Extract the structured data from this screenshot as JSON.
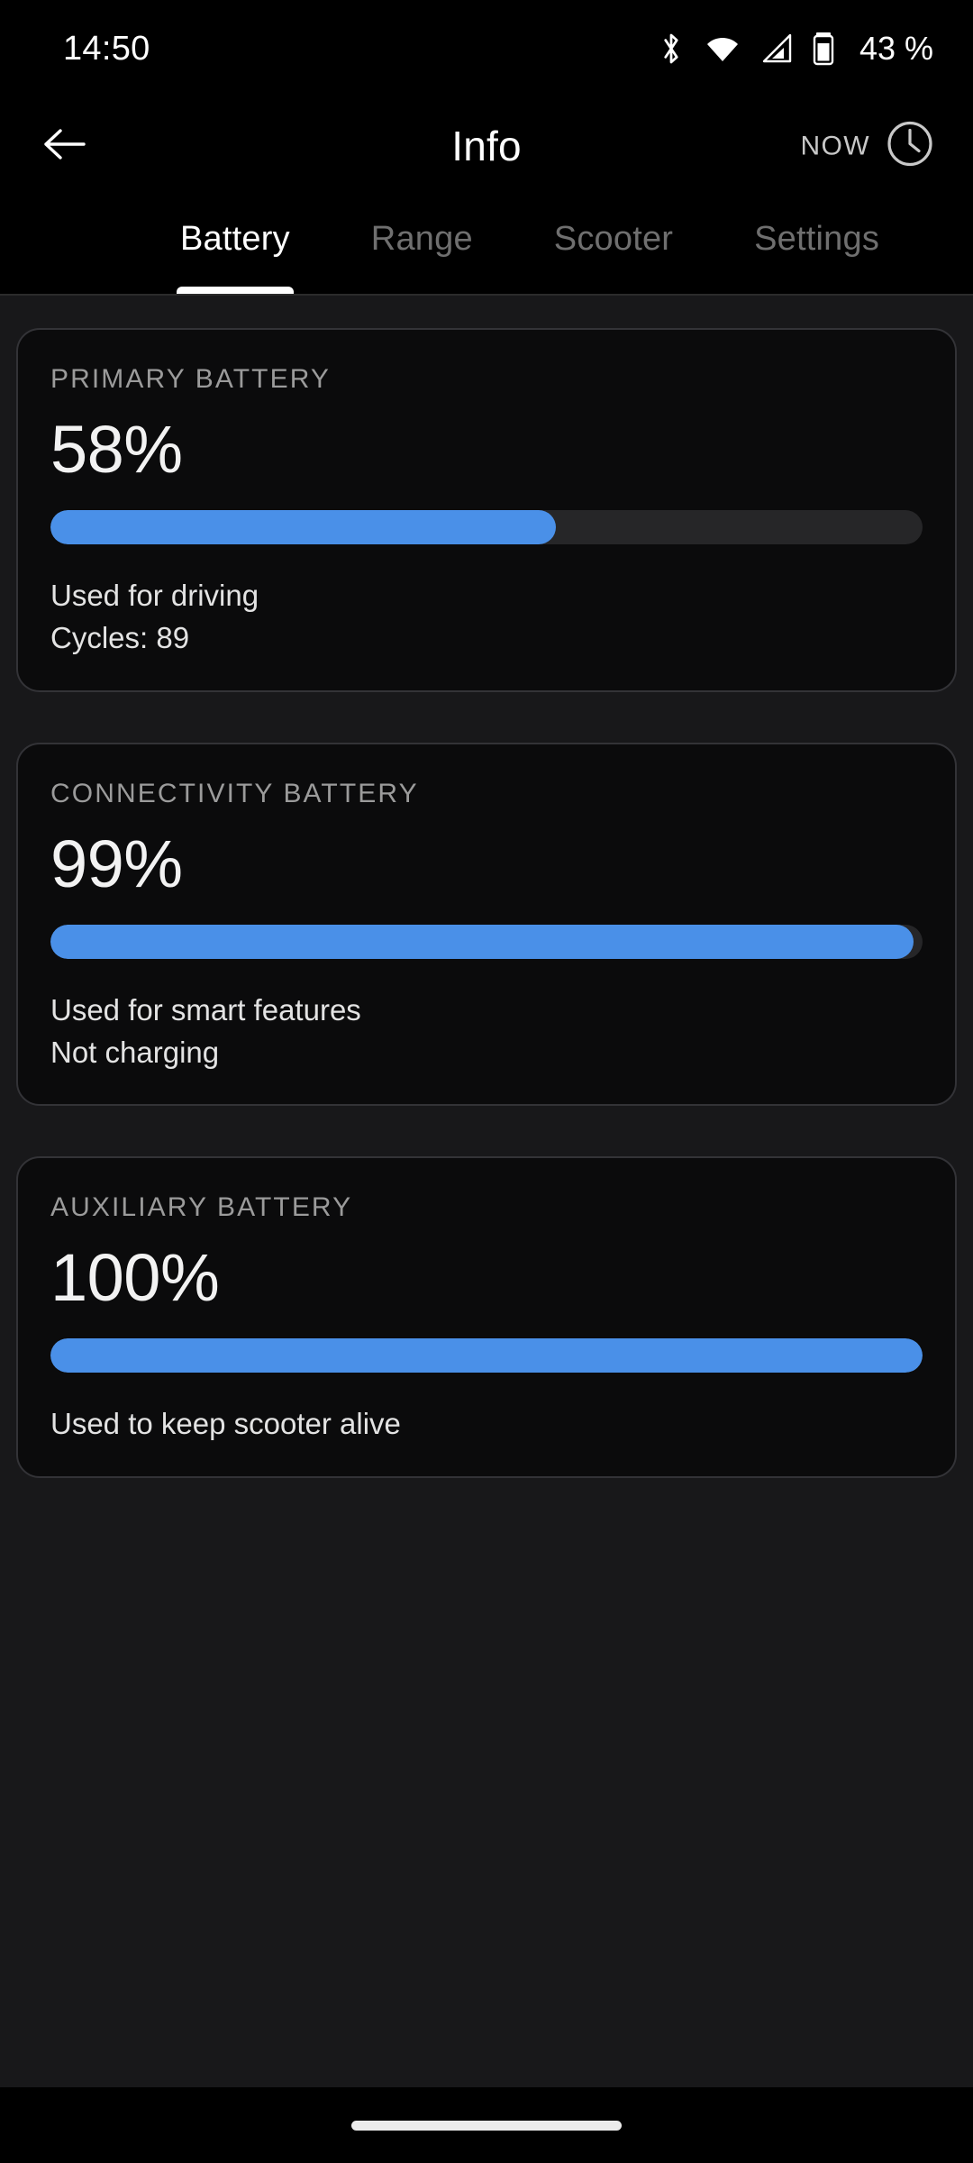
{
  "status_bar": {
    "time": "14:50",
    "battery_percent": "43 %",
    "icons": [
      "bluetooth-icon",
      "wifi-icon",
      "cellular-signal-icon",
      "battery-icon"
    ]
  },
  "app_bar": {
    "back_icon": "back-arrow-icon",
    "title": "Info",
    "now_label": "NOW",
    "clock_icon": "clock-icon"
  },
  "tabs": [
    {
      "label": "Battery",
      "active": true
    },
    {
      "label": "Range",
      "active": false
    },
    {
      "label": "Scooter",
      "active": false
    },
    {
      "label": "Settings",
      "active": false
    }
  ],
  "cards": [
    {
      "label": "PRIMARY BATTERY",
      "value": "58%",
      "percent": 58,
      "note_1": "Used for driving",
      "note_2": "Cycles: 89"
    },
    {
      "label": "CONNECTIVITY BATTERY",
      "value": "99%",
      "percent": 99,
      "note_1": "Used for smart features",
      "note_2": "Not charging"
    },
    {
      "label": "AUXILIARY BATTERY",
      "value": "100%",
      "percent": 100,
      "note_1": "Used to keep scooter alive",
      "note_2": ""
    }
  ],
  "colors": {
    "accent_blue": "#4a90e8",
    "track_gray": "#262628",
    "card_bg": "#0b0b0c",
    "card_border": "#333337",
    "content_bg": "#18181a",
    "bar_bg": "#000000",
    "text_primary": "#ffffff",
    "text_muted": "#9b9b9b",
    "tab_inactive": "#6f6f6f"
  }
}
